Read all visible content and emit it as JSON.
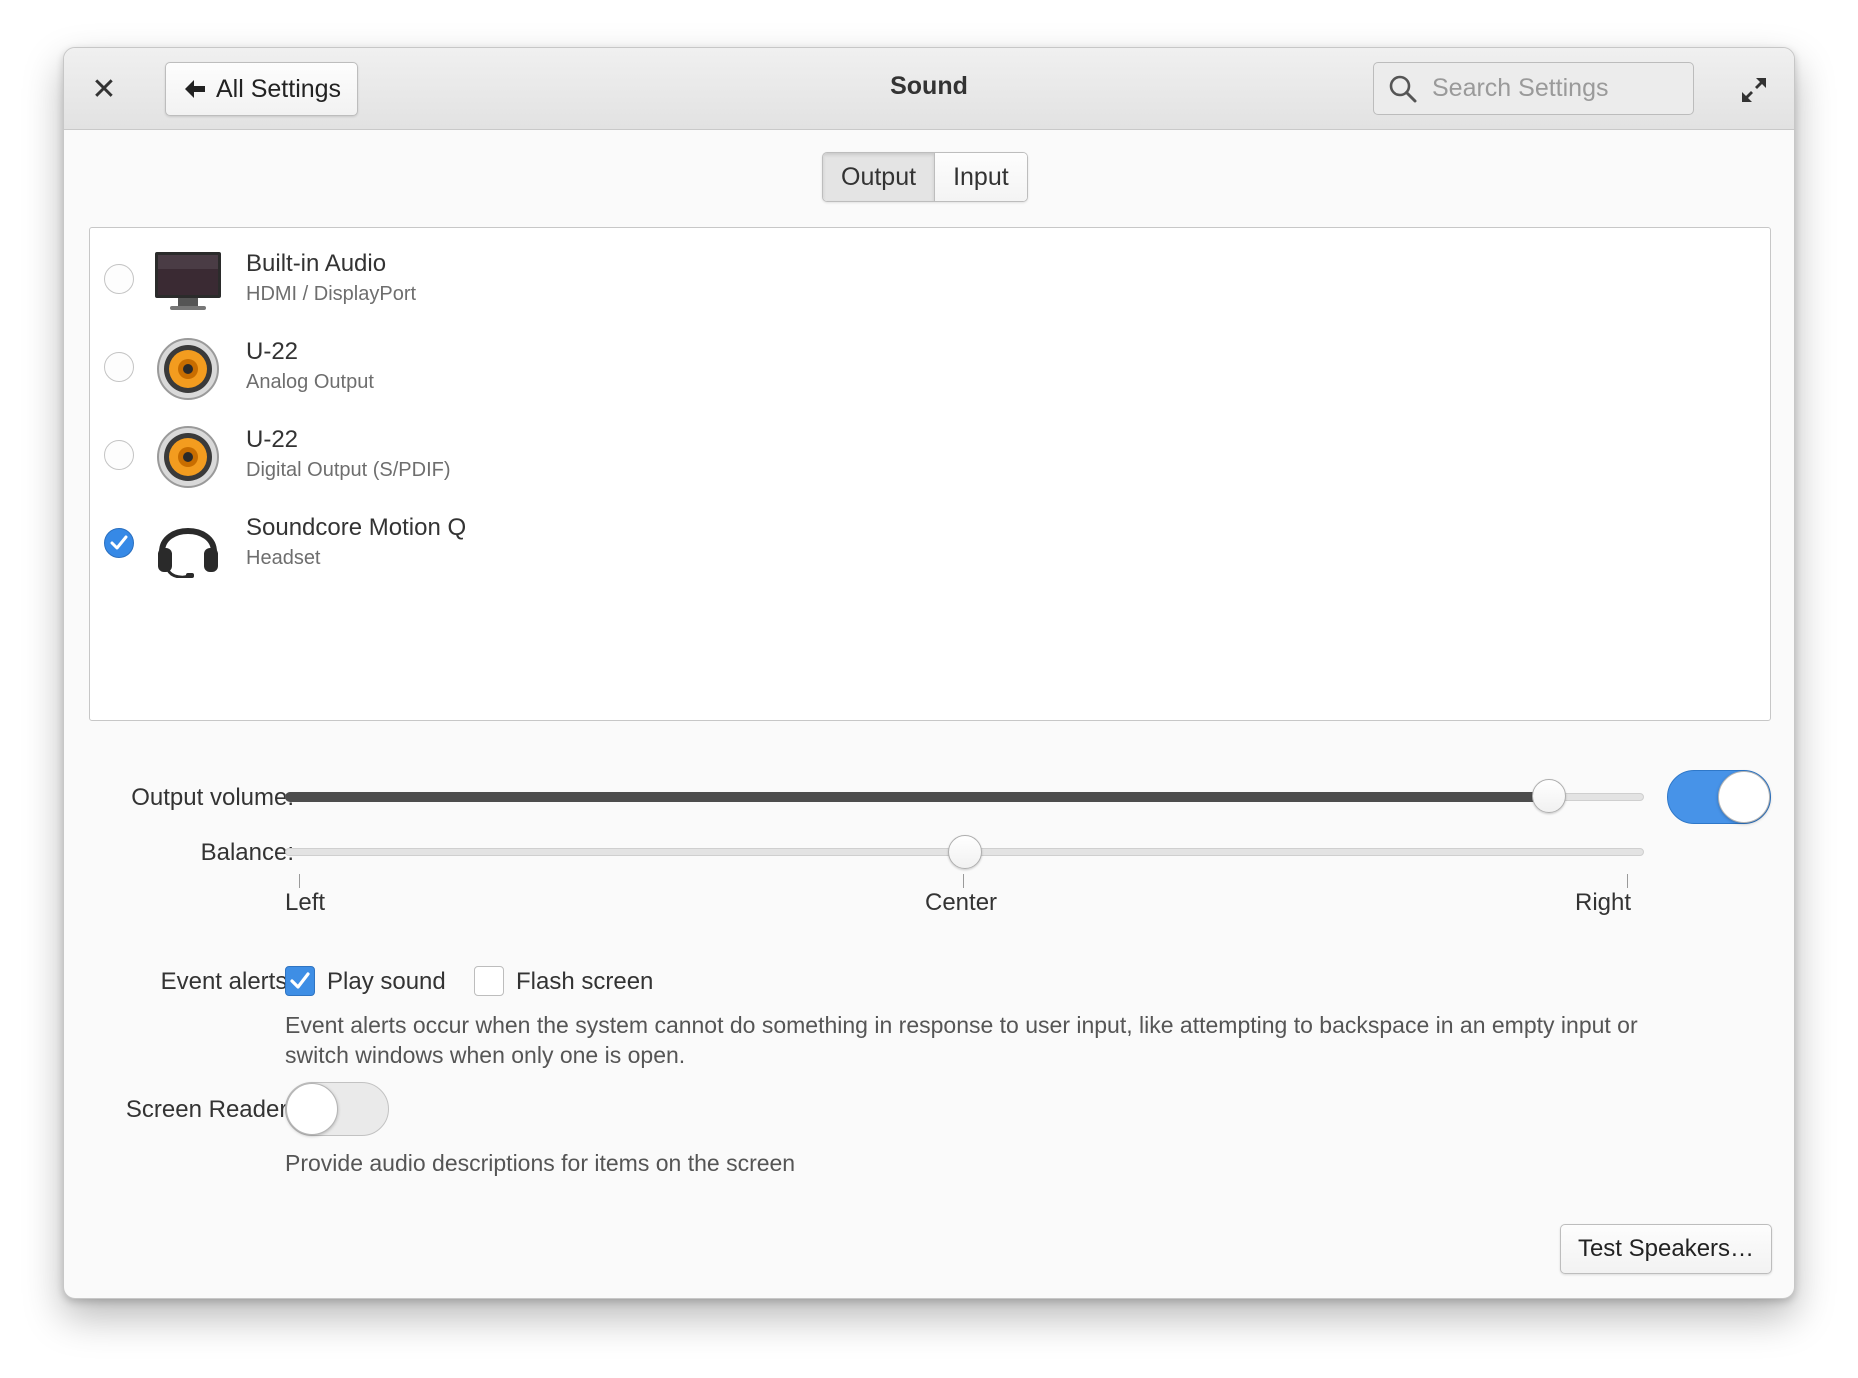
{
  "window": {
    "title": "Sound",
    "back_label": "All Settings",
    "search_placeholder": "Search Settings"
  },
  "tabs": [
    {
      "label": "Output",
      "active": true
    },
    {
      "label": "Input",
      "active": false
    }
  ],
  "devices": [
    {
      "name": "Built-in Audio",
      "description": "HDMI / DisplayPort",
      "icon": "monitor-icon",
      "selected": false
    },
    {
      "name": "U-22",
      "description": "Analog Output",
      "icon": "speaker-icon",
      "selected": false
    },
    {
      "name": "U-22",
      "description": "Digital Output (S/PDIF)",
      "icon": "speaker-icon",
      "selected": false
    },
    {
      "name": "Soundcore Motion Q",
      "description": "Headset",
      "icon": "headset-icon",
      "selected": true
    }
  ],
  "volume": {
    "label": "Output volume:",
    "level": 0.93,
    "enabled": true
  },
  "balance": {
    "label": "Balance:",
    "value": 0.5,
    "marks": [
      "Left",
      "Center",
      "Right"
    ]
  },
  "event_alerts": {
    "label": "Event alerts:",
    "play_sound": {
      "label": "Play sound",
      "checked": true
    },
    "flash_screen": {
      "label": "Flash screen",
      "checked": false
    },
    "help": "Event alerts occur when the system cannot do something in response to user input, like attempting to backspace in an empty input or switch windows when only one is open."
  },
  "screen_reader": {
    "label": "Screen Reader:",
    "enabled": false,
    "help": "Provide audio descriptions for items on the screen"
  },
  "test_button": "Test Speakers…",
  "colors": {
    "accent": "#3689e6",
    "switch_on": "#4793e8",
    "speaker_orange": "#f39c1f"
  }
}
